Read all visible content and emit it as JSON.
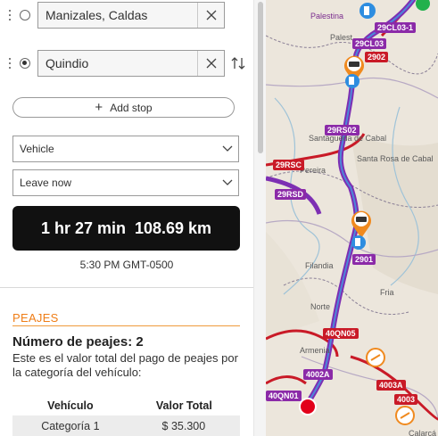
{
  "stops": [
    {
      "value": "Manizales, Caldas"
    },
    {
      "value": "Quindio"
    }
  ],
  "add_stop_label": "Add stop",
  "selects": {
    "vehicle": "Vehicle",
    "leave": "Leave now"
  },
  "summary": {
    "duration": "1 hr 27 min",
    "distance": "108.69 km"
  },
  "arrival_time": "5:30 PM GMT-0500",
  "peajes": {
    "title": "PEAJES",
    "count_label": "Número de peajes: 2",
    "description": "Este es el valor total del pago de peajes por la categoría del vehículo:",
    "table": {
      "headers": [
        "Vehículo",
        "Valor Total"
      ],
      "rows": [
        [
          "Categoría 1",
          "$ 35.300"
        ]
      ]
    }
  },
  "map": {
    "places": [
      "Palestina",
      "Palest",
      "Santágueda de Cabal",
      "Santa Rosa de Cabal",
      "Pereira",
      "Filandia",
      "Norte",
      "Fria",
      "Armenia",
      "Calarcá"
    ],
    "route_labels": [
      "29CL03",
      "29CL03-1",
      "2902",
      "29RS02",
      "29RSC",
      "29RSD",
      "2901",
      "40QN05",
      "4002A",
      "4003A",
      "40QN01",
      "4003"
    ],
    "colors": {
      "route": "#7d2fb3",
      "highway": "#c91a27",
      "toll": "#f08a1f"
    }
  }
}
